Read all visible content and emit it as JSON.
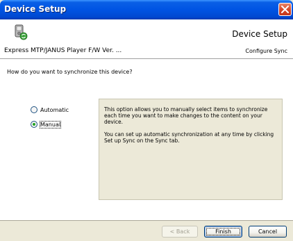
{
  "window": {
    "title": "Device Setup"
  },
  "header": {
    "title": "Device Setup",
    "device_name": "Express MTP/JANUS Player F/W Ver. ...",
    "step": "Configure Sync"
  },
  "content": {
    "question": "How do you want to synchronize this device?",
    "options": [
      {
        "label": "Automatic",
        "checked": false
      },
      {
        "label": "Manual",
        "checked": true
      }
    ],
    "description": [
      "This option allows you to manually select items to synchronize each time you want to make changes to the content on your device.",
      "You can set up automatic synchronization at any time by clicking Set up Sync on the Sync tab."
    ]
  },
  "buttons": {
    "back": "< Back",
    "finish": "Finish",
    "cancel": "Cancel"
  },
  "icons": {
    "close": "close-icon",
    "device": "device-sync-icon"
  },
  "colors": {
    "titlebar": "#0054E3",
    "dialog_bg": "#ECE9D8",
    "radio_dot": "#21A121"
  }
}
